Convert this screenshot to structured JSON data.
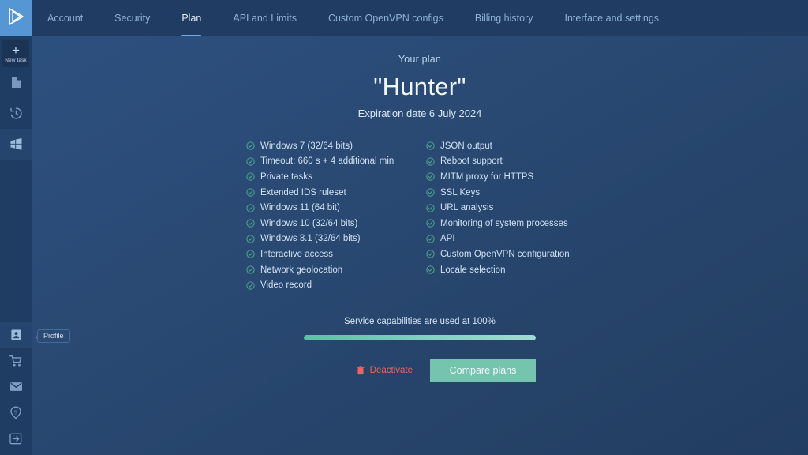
{
  "app": {
    "logo_icon": "play-triangle-logo"
  },
  "sidebar": {
    "new_task": {
      "label": "New task",
      "icon": "plus-icon"
    },
    "top_items": [
      {
        "name": "tasks",
        "icon": "file-document-icon",
        "active": false
      },
      {
        "name": "history",
        "icon": "history-clock-icon",
        "active": false
      },
      {
        "name": "windows",
        "icon": "windows-logo-icon",
        "active": true
      }
    ],
    "bottom_items": [
      {
        "name": "profile",
        "icon": "user-profile-icon",
        "active": true
      },
      {
        "name": "store",
        "icon": "shopping-cart-icon",
        "active": false
      },
      {
        "name": "mail",
        "icon": "envelope-icon",
        "active": false
      },
      {
        "name": "help",
        "icon": "help-question-icon",
        "active": false
      },
      {
        "name": "logout",
        "icon": "logout-arrow-icon",
        "active": false
      }
    ],
    "tooltip": "Profile"
  },
  "topbar": {
    "tabs": [
      {
        "label": "Account",
        "active": false
      },
      {
        "label": "Security",
        "active": false
      },
      {
        "label": "Plan",
        "active": true
      },
      {
        "label": "API and Limits",
        "active": false
      },
      {
        "label": "Custom OpenVPN configs",
        "active": false
      },
      {
        "label": "Billing history",
        "active": false
      },
      {
        "label": "Interface and settings",
        "active": false
      }
    ]
  },
  "plan": {
    "heading": "Your plan",
    "name": "\"Hunter\"",
    "expiration": "Expiration date 6 July 2024",
    "features_left": [
      "Windows 7 (32/64 bits)",
      "Timeout: 660 s + 4 additional min",
      "Private tasks",
      "Extended IDS ruleset",
      "Windows 11 (64 bit)",
      "Windows 10 (32/64 bits)",
      "Windows 8.1 (32/64 bits)",
      "Interactive access",
      "Network geolocation",
      "Video record"
    ],
    "features_right": [
      "JSON output",
      "Reboot support",
      "MITM proxy for HTTPS",
      "SSL Keys",
      "URL analysis",
      "Monitoring of system processes",
      "API",
      "Custom OpenVPN configuration",
      "Locale selection"
    ],
    "usage_text": "Service capabilities are used at 100%",
    "usage_percent": 100,
    "deactivate_label": "Deactivate",
    "compare_label": "Compare plans"
  },
  "colors": {
    "accent_green": "#74c4ae",
    "danger_red": "#e8675f",
    "tab_underline": "#6fa9e6",
    "check_green": "#4fa98c",
    "sidebar_bg": "#1f3c63",
    "topbar_bg": "#203c62"
  }
}
